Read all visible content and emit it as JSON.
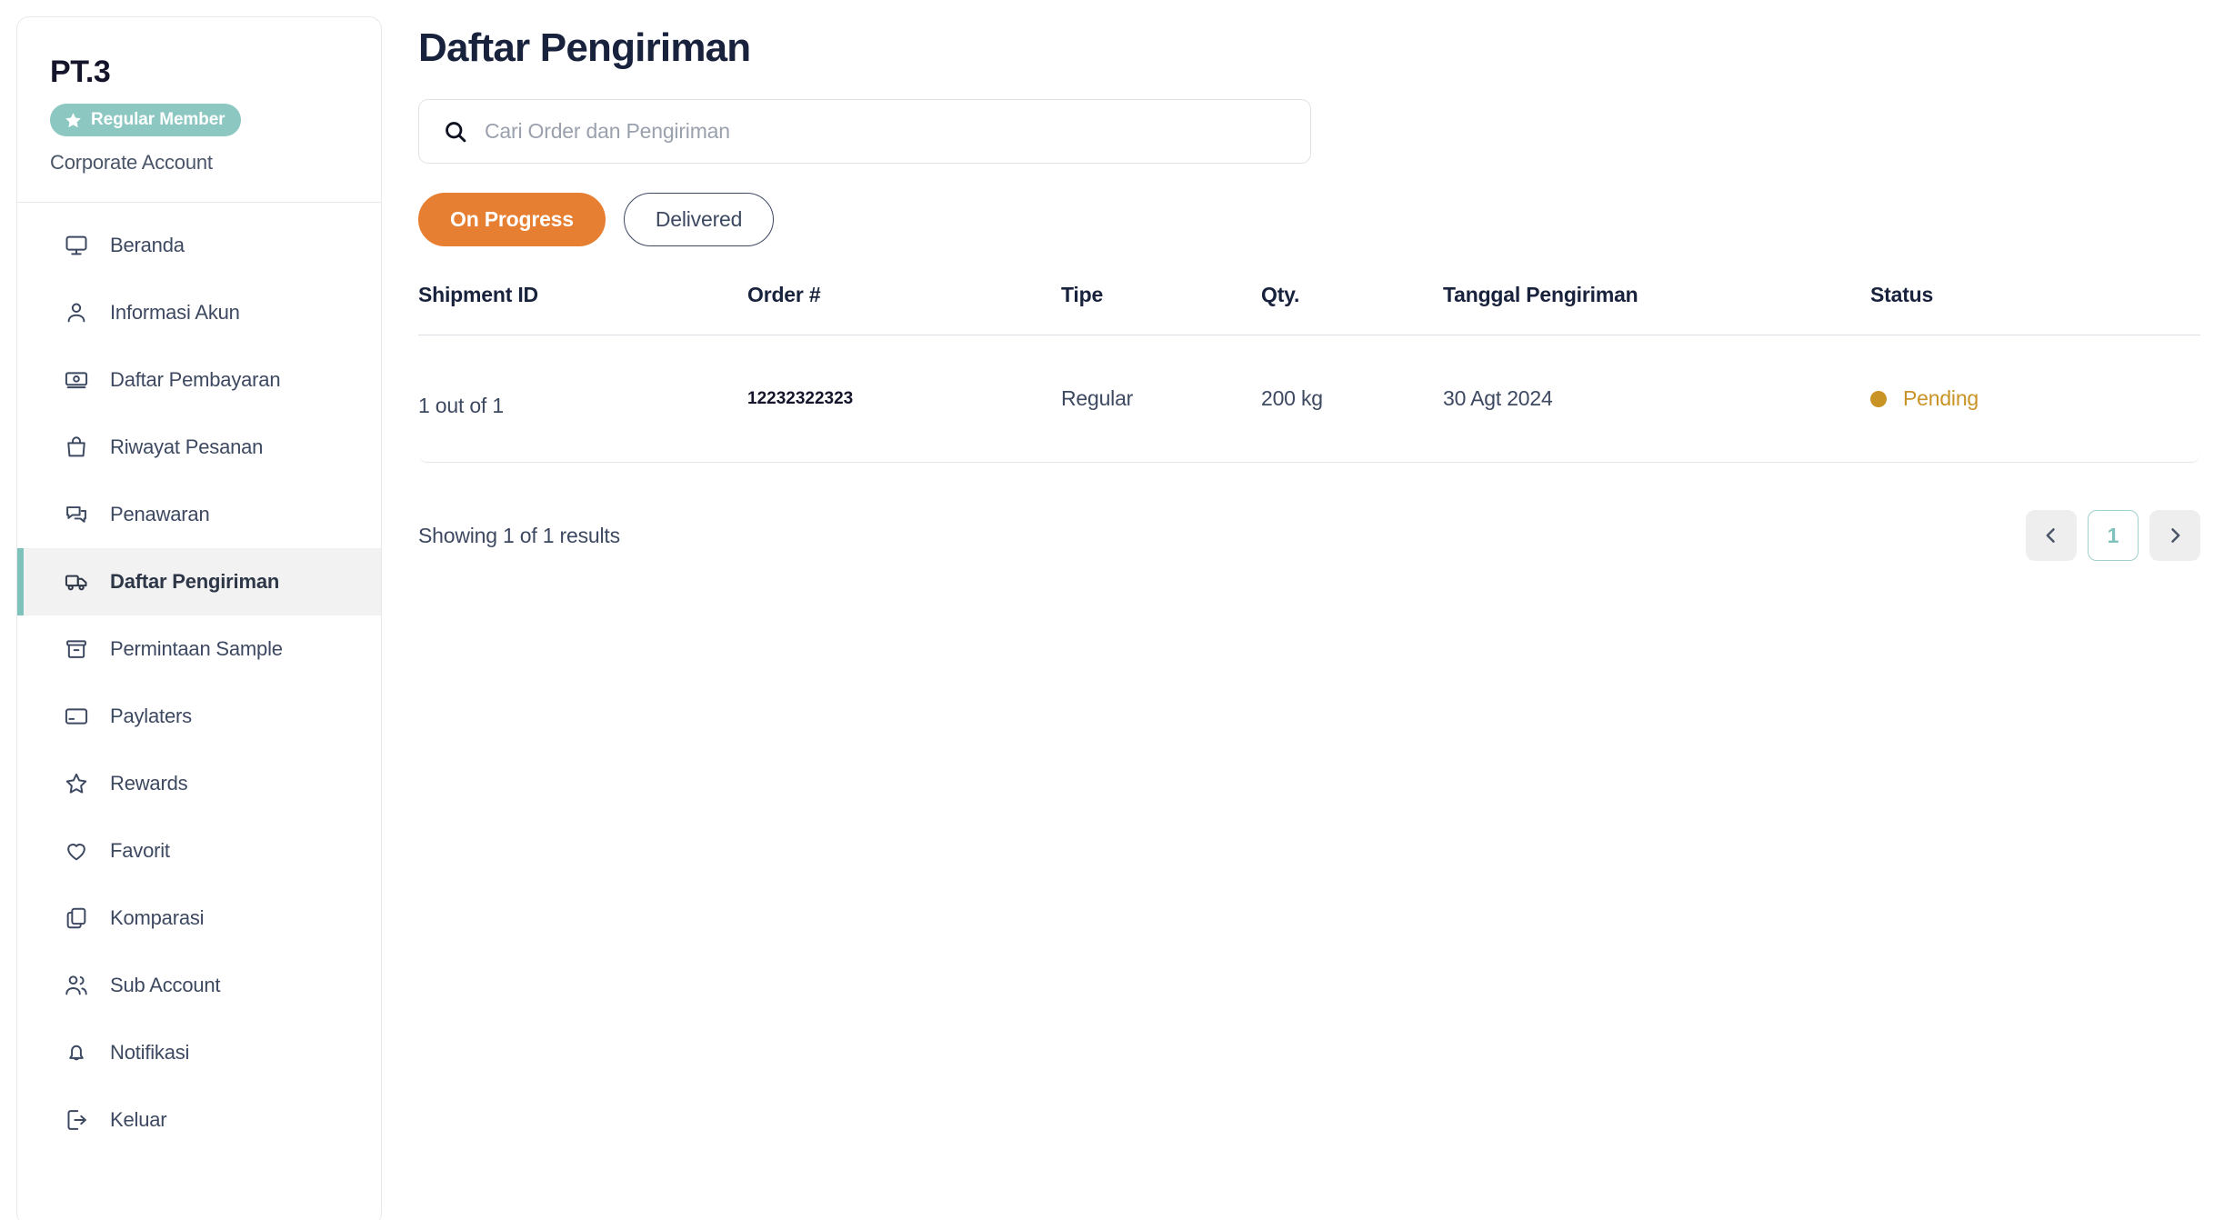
{
  "sidebar": {
    "company": "PT.3",
    "badge": {
      "label": "Regular Member",
      "icon": "star-icon",
      "color": "#8cc7c1"
    },
    "account_type": "Corporate Account",
    "items": [
      {
        "label": "Beranda",
        "icon": "monitor-icon",
        "active": false
      },
      {
        "label": "Informasi Akun",
        "icon": "user-icon",
        "active": false
      },
      {
        "label": "Daftar Pembayaran",
        "icon": "money-icon",
        "active": false
      },
      {
        "label": "Riwayat Pesanan",
        "icon": "bag-icon",
        "active": false
      },
      {
        "label": "Penawaran",
        "icon": "chat-icon",
        "active": false
      },
      {
        "label": "Daftar Pengiriman",
        "icon": "truck-icon",
        "active": true
      },
      {
        "label": "Permintaan Sample",
        "icon": "box-icon",
        "active": false
      },
      {
        "label": "Paylaters",
        "icon": "card-icon",
        "active": false
      },
      {
        "label": "Rewards",
        "icon": "star-outline-icon",
        "active": false
      },
      {
        "label": "Favorit",
        "icon": "heart-icon",
        "active": false
      },
      {
        "label": "Komparasi",
        "icon": "copy-icon",
        "active": false
      },
      {
        "label": "Sub Account",
        "icon": "users-icon",
        "active": false
      },
      {
        "label": "Notifikasi",
        "icon": "bell-icon",
        "active": false
      },
      {
        "label": "Keluar",
        "icon": "logout-icon",
        "active": false
      }
    ]
  },
  "main": {
    "page_title": "Daftar Pengiriman",
    "search": {
      "placeholder": "Cari Order dan Pengiriman",
      "value": "",
      "icon": "search-icon"
    },
    "filters": [
      {
        "label": "On Progress",
        "active": true,
        "color": "#e77f32"
      },
      {
        "label": "Delivered",
        "active": false
      }
    ],
    "table": {
      "columns": [
        "Shipment ID",
        "Order #",
        "Tipe",
        "Qty.",
        "Tanggal Pengiriman",
        "Status"
      ],
      "rows": [
        {
          "shipment_id": "1 out of 1",
          "order_no": "12232322323",
          "tipe": "Regular",
          "qty": "200 kg",
          "tanggal_pengiriman": "30 Agt 2024",
          "status": "Pending",
          "status_color": "#c99326"
        }
      ]
    },
    "footer": {
      "showing": "Showing 1 of 1 results",
      "pagination": {
        "prev": "‹",
        "next": "›",
        "pages": [
          "1"
        ],
        "current": "1"
      }
    }
  }
}
